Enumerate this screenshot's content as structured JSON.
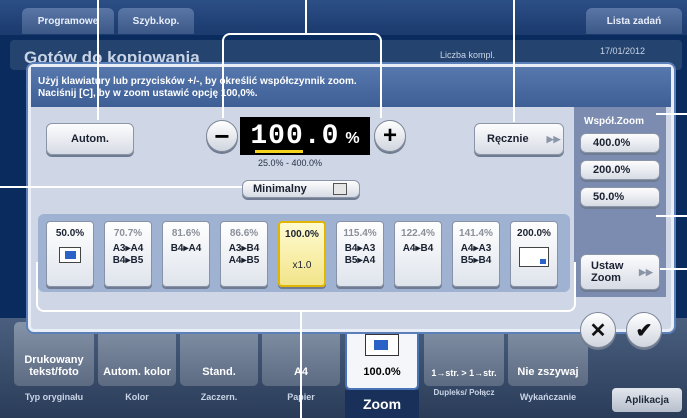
{
  "background": {
    "tabs": [
      "Programowe",
      "Szyb.kop.",
      "Lista zadań"
    ],
    "title": "Gotów do kopiowania",
    "copies_label": "Liczba kompl.",
    "date": "17/01/2012",
    "bottom_buttons": [
      {
        "label": "Drukowany tekst/foto",
        "caption": "Typ oryginału"
      },
      {
        "label": "Autom. kolor",
        "caption": "Kolor"
      },
      {
        "label": "Stand.",
        "caption": "Zaczern."
      },
      {
        "label": "A4",
        "caption": "Papier"
      },
      {
        "label": "100.0%",
        "caption": "Zoom"
      },
      {
        "label": "1→str. > 1→str.",
        "caption": "Dupleks/ Połącz"
      },
      {
        "label": "Nie zszywaj",
        "caption": "Wykańczanie"
      }
    ],
    "app_button": "Aplikacja"
  },
  "dialog": {
    "message_line1": "Użyj klawiatury lub przycisków +/-, by określić współczynnik zoom.",
    "message_line2": "Naciśnij [C], by w zoom ustawić opcję 100,0%.",
    "auto_label": "Autom.",
    "zoom_value": "100.0",
    "zoom_unit": "%",
    "range": "25.0% - 400.0%",
    "manual_label": "Ręcznie",
    "minimal_label": "Minimalny",
    "presets": [
      {
        "pct": "50.0%",
        "sub": ""
      },
      {
        "pct": "70.7%",
        "sub": "A3▸A4 B4▸B5"
      },
      {
        "pct": "81.6%",
        "sub": "B4▸A4"
      },
      {
        "pct": "86.6%",
        "sub": "A3▸B4 A4▸B5"
      },
      {
        "pct": "100.0%",
        "sub": "x1.0"
      },
      {
        "pct": "115.4%",
        "sub": "B4▸A3 B5▸A4"
      },
      {
        "pct": "122.4%",
        "sub": "A4▸B4"
      },
      {
        "pct": "141.4%",
        "sub": "A4▸A3 B5▸B4"
      },
      {
        "pct": "200.0%",
        "sub": ""
      }
    ],
    "selected_preset": 4,
    "zoom_panel_title": "Współ.Zoom",
    "zoom_buttons": [
      "400.0%",
      "200.0%",
      "50.0%"
    ],
    "set_zoom_label": "Ustaw Zoom",
    "cancel_symbol": "✕",
    "ok_symbol": "✔"
  }
}
